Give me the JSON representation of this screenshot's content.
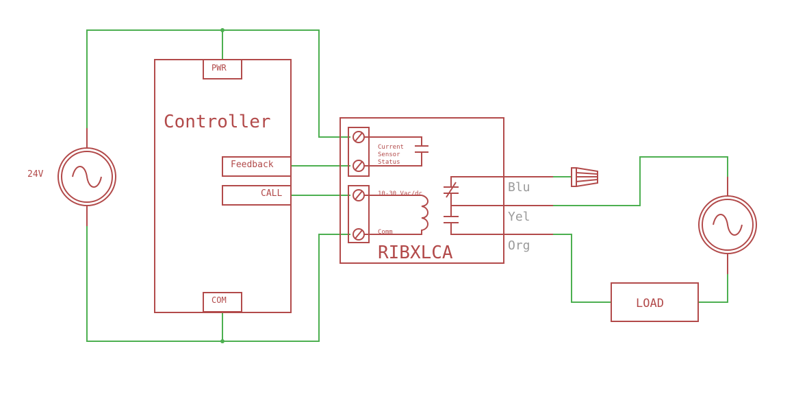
{
  "colors": {
    "component": "#b24a4a",
    "wire": "#4caf50",
    "pin_label": "#9a9a9a"
  },
  "source_left": {
    "label": "24V",
    "icon": "ac-source-icon"
  },
  "controller": {
    "title": "Controller",
    "pins": {
      "pwr": "PWR",
      "com": "COM",
      "feedback": "Feedback",
      "call": "CALL"
    }
  },
  "relay": {
    "title": "RIBXLCA",
    "sensor_label": [
      "Current",
      "Sensor",
      "Status"
    ],
    "coil_label": "10-30 Vac/dc",
    "comm_label": "Comm",
    "leads": {
      "blu": "Blu",
      "yel": "Yel",
      "org": "Org"
    }
  },
  "load": {
    "label": "LOAD"
  },
  "source_right": {
    "icon": "ac-source-icon"
  },
  "wire_nut": {
    "icon": "wire-nut-icon"
  }
}
